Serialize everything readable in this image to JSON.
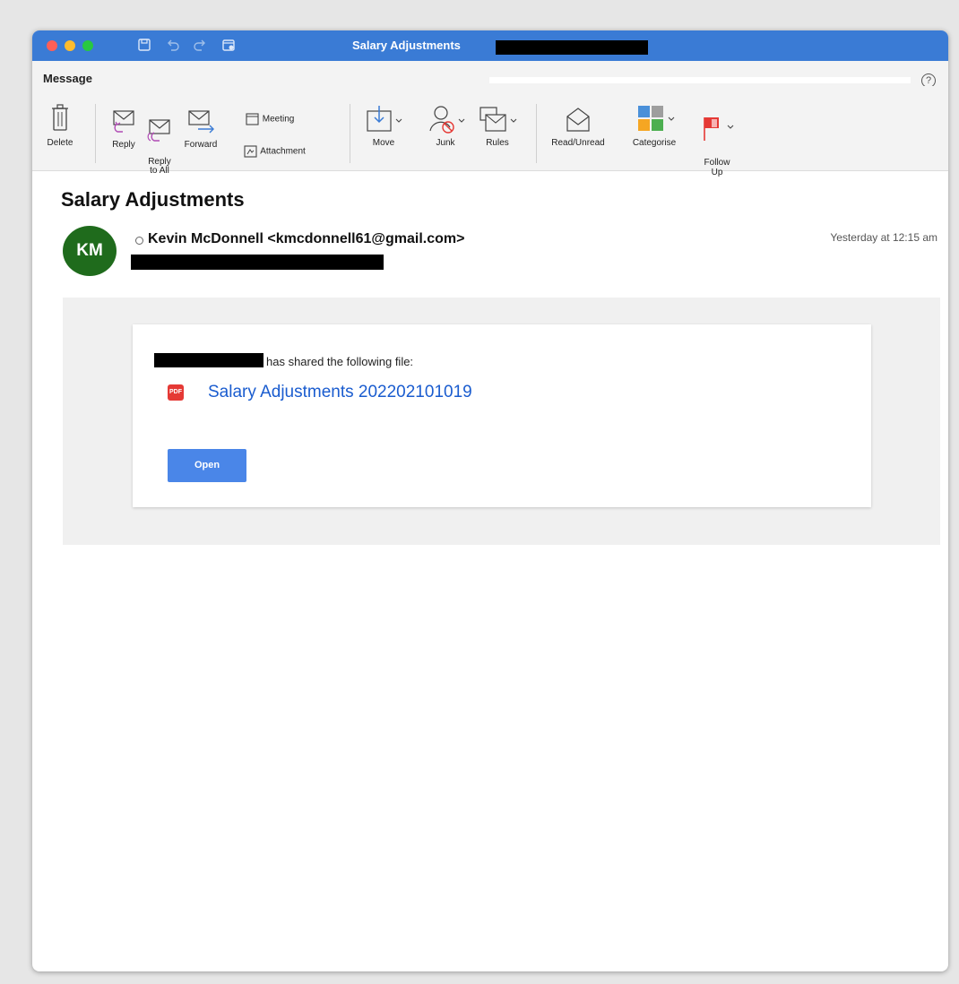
{
  "window": {
    "title": "Salary Adjustments"
  },
  "ribbon": {
    "tab_message": "Message",
    "delete": "Delete",
    "reply": "Reply",
    "reply_all": "Reply\nto All",
    "forward": "Forward",
    "meeting": "Meeting",
    "attachment": "Attachment",
    "move": "Move",
    "junk": "Junk",
    "rules": "Rules",
    "read_unread": "Read/Unread",
    "categorise": "Categorise",
    "follow_up": "Follow\nUp",
    "help": "?"
  },
  "email": {
    "subject": "Salary Adjustments",
    "avatar_initials": "KM",
    "sender": "Kevin McDonnell <kmcdonnell61@gmail.com>",
    "date": "Yesterday at 12:15 am",
    "shared_text": "has shared the following file:",
    "pdf_label": "PDF",
    "file_name": "Salary Adjustments 202202101019",
    "open_button": "Open"
  },
  "colors": {
    "titlebar": "#3a7bd5",
    "avatar": "#1f6b1c",
    "link": "#1a5ccf",
    "button": "#4a86e8",
    "pdf": "#e53935"
  }
}
